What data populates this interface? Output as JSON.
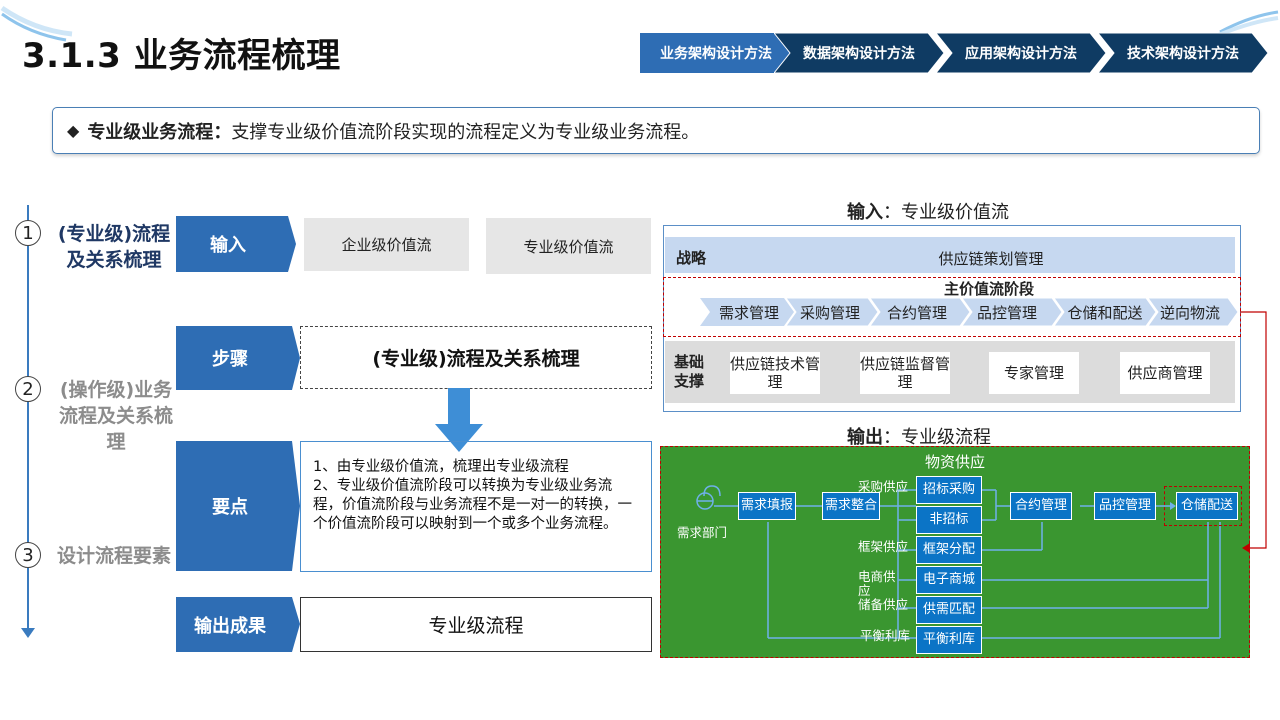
{
  "header": {
    "title": "3.1.3 业务流程梳理",
    "breadcrumbs": [
      "业务架构设计方法",
      "数据架构设计方法",
      "应用架构设计方法",
      "技术架构设计方法"
    ]
  },
  "definition": {
    "bullet": "◆",
    "term": "专业级业务流程",
    "sep": "：",
    "text": "支撑专业级价值流阶段实现的流程定义为专业级业务流程。"
  },
  "timeline": {
    "steps": [
      {
        "num": "1",
        "label": "(专业级)流程及关系梳理"
      },
      {
        "num": "2",
        "label": "(操作级)业务流程及关系梳理"
      },
      {
        "num": "3",
        "label": "设计流程要素"
      }
    ]
  },
  "rows": {
    "input": {
      "tab": "输入",
      "boxes": [
        "企业级价值流",
        "专业级价值流"
      ]
    },
    "steps": {
      "tab": "步骤",
      "content": "(专业级)流程及关系梳理"
    },
    "points": {
      "tab": "要点",
      "lines": [
        "1、由专业级价值流，梳理出专业级流程",
        "2、专业级价值流阶段可以转换为专业级业务流程，价值流阶段与业务流程不是一对一的转换，一个价值流阶段可以映射到一个或多个业务流程。"
      ]
    },
    "output": {
      "tab": "输出成果",
      "content": "专业级流程"
    }
  },
  "value_chain": {
    "heading_bold": "输入",
    "heading_text": "：专业级价值流",
    "strategy_label": "战略",
    "strategy_item": "供应链策划管理",
    "main_label": "主价值流阶段",
    "stages": [
      "需求管理",
      "采购管理",
      "合约管理",
      "品控管理",
      "仓储和配送",
      "逆向物流"
    ],
    "support_label": "基础支撑",
    "support_items": [
      "供应链技术管理",
      "供应链监督管理",
      "专家管理",
      "供应商管理"
    ]
  },
  "flow": {
    "heading_bold": "输出",
    "heading_text": "：专业级流程",
    "title": "物资供应",
    "start_label": "需求部门",
    "boxes": {
      "demand_fill": "需求填报",
      "demand_merge": "需求整合",
      "tender": "招标采购",
      "non_tender": "非招标",
      "framework": "框架分配",
      "emall": "电子商城",
      "match": "供需匹配",
      "balance": "平衡利库",
      "contract": "合约管理",
      "quality": "品控管理",
      "warehouse": "仓储配送"
    },
    "labels": {
      "purchase": "采购供应",
      "framework": "框架供应",
      "emall": "电商供应",
      "reserve": "储备供应",
      "balance": "平衡利库"
    }
  },
  "colors": {
    "accent": "#2e6db4",
    "crumb_active": "#2e6db4",
    "crumb_inactive": "#0f3b63",
    "green_bg": "#3a9630",
    "flow_box": "#0b74c6",
    "dashed_red": "#c00000"
  }
}
